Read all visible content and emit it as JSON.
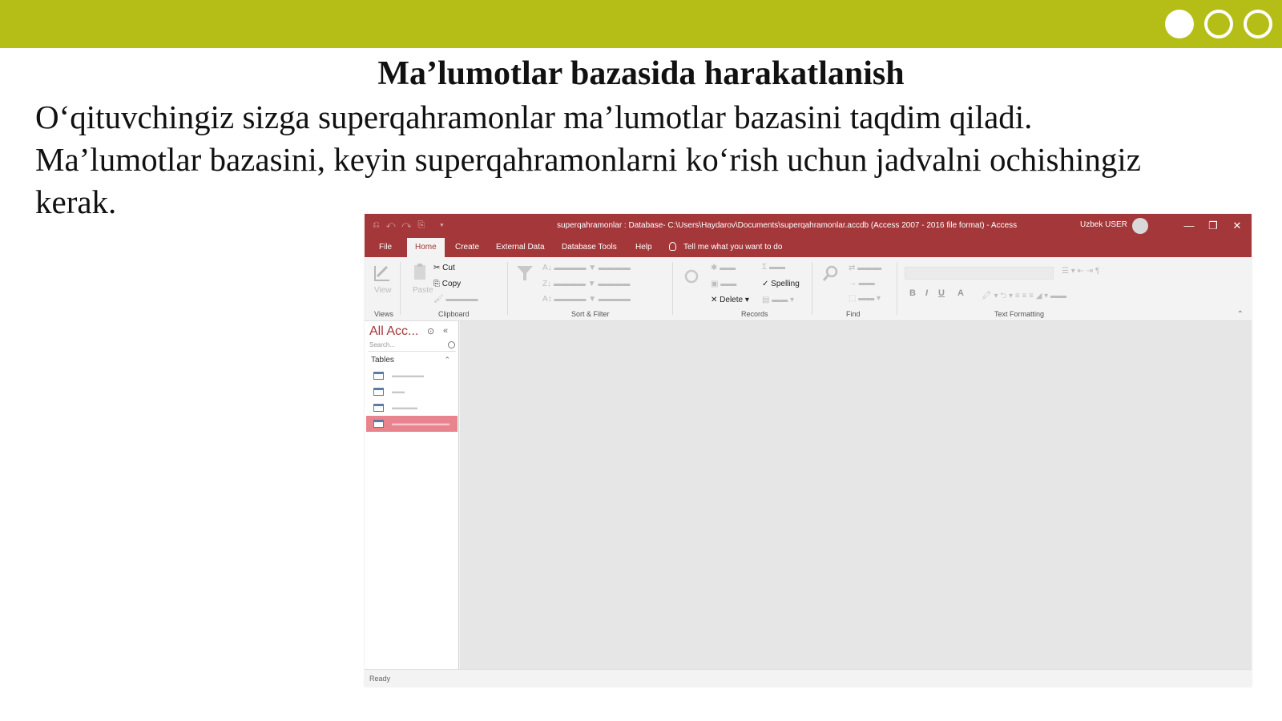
{
  "slide": {
    "title": "Ma’lumotlar bazasida harakatlanish",
    "body": "O‘qituvchingiz sizga superqahramonlar ma’lumotlar bazasini taqdim qiladi. Ma’lumotlar bazasini, keyin superqahramonlarni ko‘rish uchun jadvalni ochishingiz kerak.",
    "accent_color": "#b5be17"
  },
  "access": {
    "titlebar": {
      "title": "superqahramonlar : Database- C:\\Users\\Haydarov\\Documents\\superqahramonlar.accdb (Access 2007 - 2016 file format) - Access",
      "user": "Uzbek USER",
      "accent_color": "#a4373a"
    },
    "tabs": [
      "File",
      "Home",
      "Create",
      "External Data",
      "Database Tools",
      "Help"
    ],
    "active_tab": "Home",
    "tell_me": "Tell me what you want to do",
    "ribbon": {
      "cut": "Cut",
      "copy": "Copy",
      "spelling": "Spelling",
      "delete": "Delete",
      "groups": {
        "views": "Views",
        "clipboard": "Clipboard",
        "sort_filter": "Sort & Filter",
        "records": "Records",
        "find": "Find",
        "text_formatting": "Text Formatting"
      }
    },
    "nav": {
      "header": "All Acc...",
      "search_placeholder": "Search...",
      "section": "Tables"
    },
    "status": "Ready"
  }
}
